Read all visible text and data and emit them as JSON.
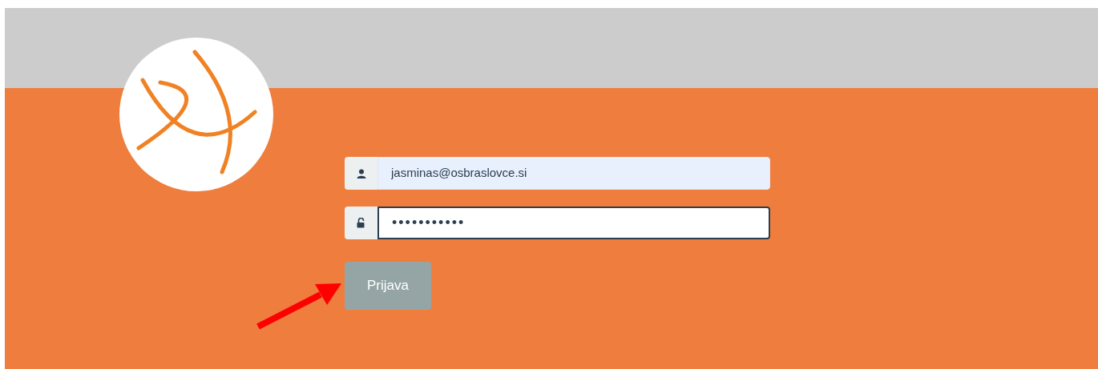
{
  "login_form": {
    "email": {
      "value": "jasminas@osbraslovce.si",
      "focused": false
    },
    "password": {
      "value": "•••••••••••",
      "focused": true
    },
    "submit_button": "Prijava"
  }
}
